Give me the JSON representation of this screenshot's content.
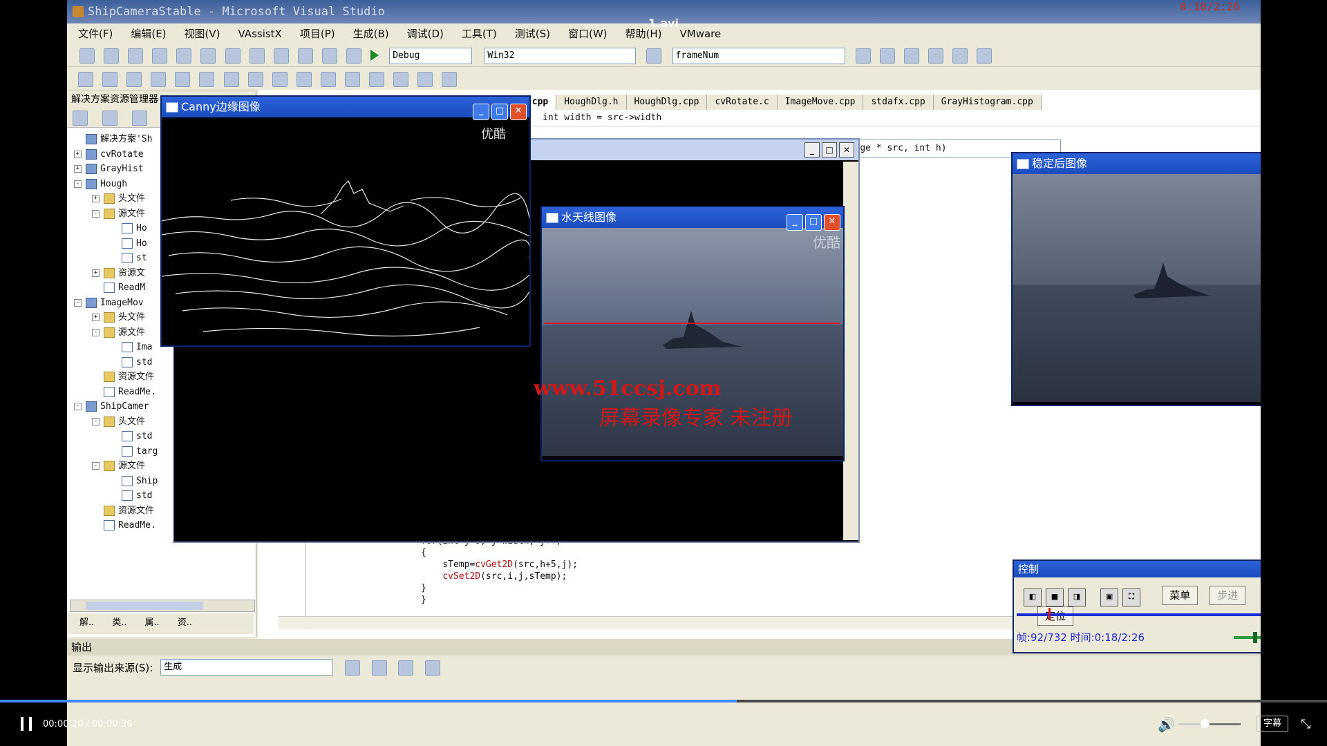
{
  "player": {
    "video_title": "1.avi",
    "time_display": "00:00:20 / 00:00:36",
    "progress_fraction": 0.555,
    "volume_fraction": 0.35,
    "subtitle_label": "字幕"
  },
  "vs": {
    "title": "ShipCameraStable - Microsoft Visual Studio",
    "overlay_time": "0:18/2:26",
    "menu": [
      "文件(F)",
      "编辑(E)",
      "视图(V)",
      "VAssistX",
      "项目(P)",
      "生成(B)",
      "调试(D)",
      "工具(T)",
      "测试(S)",
      "窗口(W)",
      "帮助(H)",
      "VMware"
    ],
    "config_combo": "Debug",
    "platform_combo": "Win32",
    "find_combo": "frameNum",
    "solution_panel_title": "解决方案资源管理器",
    "tree": [
      {
        "indent": 0,
        "toggle": "",
        "icon": "p",
        "label": "解决方案'Sh"
      },
      {
        "indent": 0,
        "toggle": "+",
        "icon": "p",
        "label": "cvRotate"
      },
      {
        "indent": 0,
        "toggle": "+",
        "icon": "p",
        "label": "GrayHist"
      },
      {
        "indent": 0,
        "toggle": "-",
        "icon": "p",
        "label": "Hough"
      },
      {
        "indent": 1,
        "toggle": "+",
        "icon": "d",
        "label": "头文件"
      },
      {
        "indent": 1,
        "toggle": "-",
        "icon": "d",
        "label": "源文件"
      },
      {
        "indent": 2,
        "toggle": "",
        "icon": "f",
        "label": "Ho"
      },
      {
        "indent": 2,
        "toggle": "",
        "icon": "f",
        "label": "Ho"
      },
      {
        "indent": 2,
        "toggle": "",
        "icon": "f",
        "label": "st"
      },
      {
        "indent": 1,
        "toggle": "+",
        "icon": "d",
        "label": "资源文"
      },
      {
        "indent": 1,
        "toggle": "",
        "icon": "f",
        "label": "ReadM"
      },
      {
        "indent": 0,
        "toggle": "-",
        "icon": "p",
        "label": "ImageMov"
      },
      {
        "indent": 1,
        "toggle": "+",
        "icon": "d",
        "label": "头文件"
      },
      {
        "indent": 1,
        "toggle": "-",
        "icon": "d",
        "label": "源文件"
      },
      {
        "indent": 2,
        "toggle": "",
        "icon": "f",
        "label": "Ima"
      },
      {
        "indent": 2,
        "toggle": "",
        "icon": "f",
        "label": "std"
      },
      {
        "indent": 1,
        "toggle": "",
        "icon": "d",
        "label": "资源文件"
      },
      {
        "indent": 1,
        "toggle": "",
        "icon": "f",
        "label": "ReadMe."
      },
      {
        "indent": 0,
        "toggle": "-",
        "icon": "p",
        "label": "ShipCamer"
      },
      {
        "indent": 1,
        "toggle": "-",
        "icon": "d",
        "label": "头文件"
      },
      {
        "indent": 2,
        "toggle": "",
        "icon": "f",
        "label": "std"
      },
      {
        "indent": 2,
        "toggle": "",
        "icon": "f",
        "label": "targ"
      },
      {
        "indent": 1,
        "toggle": "-",
        "icon": "d",
        "label": "源文件"
      },
      {
        "indent": 2,
        "toggle": "",
        "icon": "f",
        "label": "Ship"
      },
      {
        "indent": 2,
        "toggle": "",
        "icon": "f",
        "label": "std"
      },
      {
        "indent": 1,
        "toggle": "",
        "icon": "d",
        "label": "资源文件"
      },
      {
        "indent": 1,
        "toggle": "",
        "icon": "f",
        "label": "ReadMe."
      }
    ],
    "panel_tabs": [
      "解..",
      "类..",
      "属..",
      "资.."
    ],
    "editor_tabs": [
      "CameraStable.cpp",
      "HoughDlg.h",
      "HoughDlg.cpp",
      "cvRotate.c",
      "ImageMove.cpp",
      "stdafx.cpp",
      "GrayHistogram.cpp"
    ],
    "code_top": "int width = src->width",
    "func_combo": "FillImage(IplImage * src, int h)",
    "code_lines": [
      {
        "pre": "for(int j=0; j<width; j++)",
        "fn": "",
        "post": ""
      },
      {
        "pre": "{",
        "fn": "",
        "post": ""
      },
      {
        "pre": "    sTemp=",
        "fn": "cvGet2D",
        "post": "(src,h+5,j);"
      },
      {
        "pre": "    ",
        "fn": "cvSet2D",
        "post": "(src,i,j,sTemp);"
      },
      {
        "pre": "}",
        "fn": "",
        "post": ""
      },
      {
        "pre": "}",
        "fn": "",
        "post": ""
      }
    ],
    "output_title": "输出",
    "output_source_label": "显示输出来源(S):",
    "output_source_value": "生成"
  },
  "windows": {
    "canny_title": "Canny边缘图像",
    "horizon_title": "水天线图像",
    "stable_title": "稳定后图像",
    "watermark": "优酷",
    "overlay_url": "www.51ccsj.com",
    "overlay_notice": "屏幕录像专家 未注册"
  },
  "control": {
    "title": "控制",
    "menu_btn": "菜单",
    "step_btn": "步进",
    "locate_btn": "定位",
    "status": "帧:92/732 时间:0:18/2:26"
  },
  "colors": {
    "accent": "#3d8bfd",
    "xp_title": "#1a4cc0",
    "horizon_line": "#e01020",
    "watermark_red": "#d01818"
  }
}
